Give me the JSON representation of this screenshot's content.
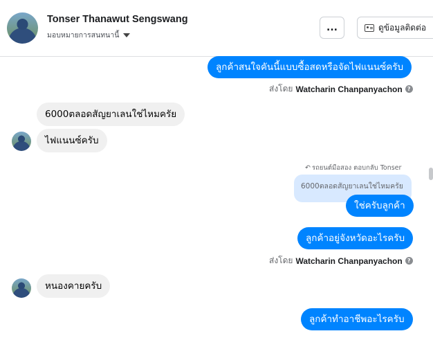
{
  "header": {
    "contact_name": "Tonser Thanawut Sengswang",
    "assign_label": "มอบหมายการสนทนานี้",
    "more_label": "...",
    "view_contact_label": "ดูข้อมูลติดต่อ"
  },
  "messages": {
    "m1": "ลูกค้าสนใจคันนี้แบบซื้อสดหรือจัดไฟแนนซ์ครับ",
    "m1_sent_by_prefix": "ส่งโดย",
    "m1_sent_by_name": "Watcharin Chanpanyachon",
    "m2": "6000ตลอดสัญยาเลนใช่ไหมครัย",
    "m3": "ไฟแนนซ์ครับ",
    "reply_label": "รถยนต์มือสอง ตอบกลับ Tonser",
    "reply_quote": "6000ตลอดสัญยาเลนใช่ไหมครัย",
    "m4": "ใช่ครับลูกค้า",
    "m5": "ลูกค้าอยู่จังหวัดอะไรครับ",
    "m5_sent_by_prefix": "ส่งโดย",
    "m5_sent_by_name": "Watcharin Chanpanyachon",
    "m6": "หนองคายครับ",
    "m7": "ลูกค้าทำอาชีพอะไรครับ"
  },
  "colors": {
    "outgoing_bubble": "#0084ff",
    "incoming_bubble": "#f0f0f0",
    "reply_bubble": "#d8e9ff"
  }
}
